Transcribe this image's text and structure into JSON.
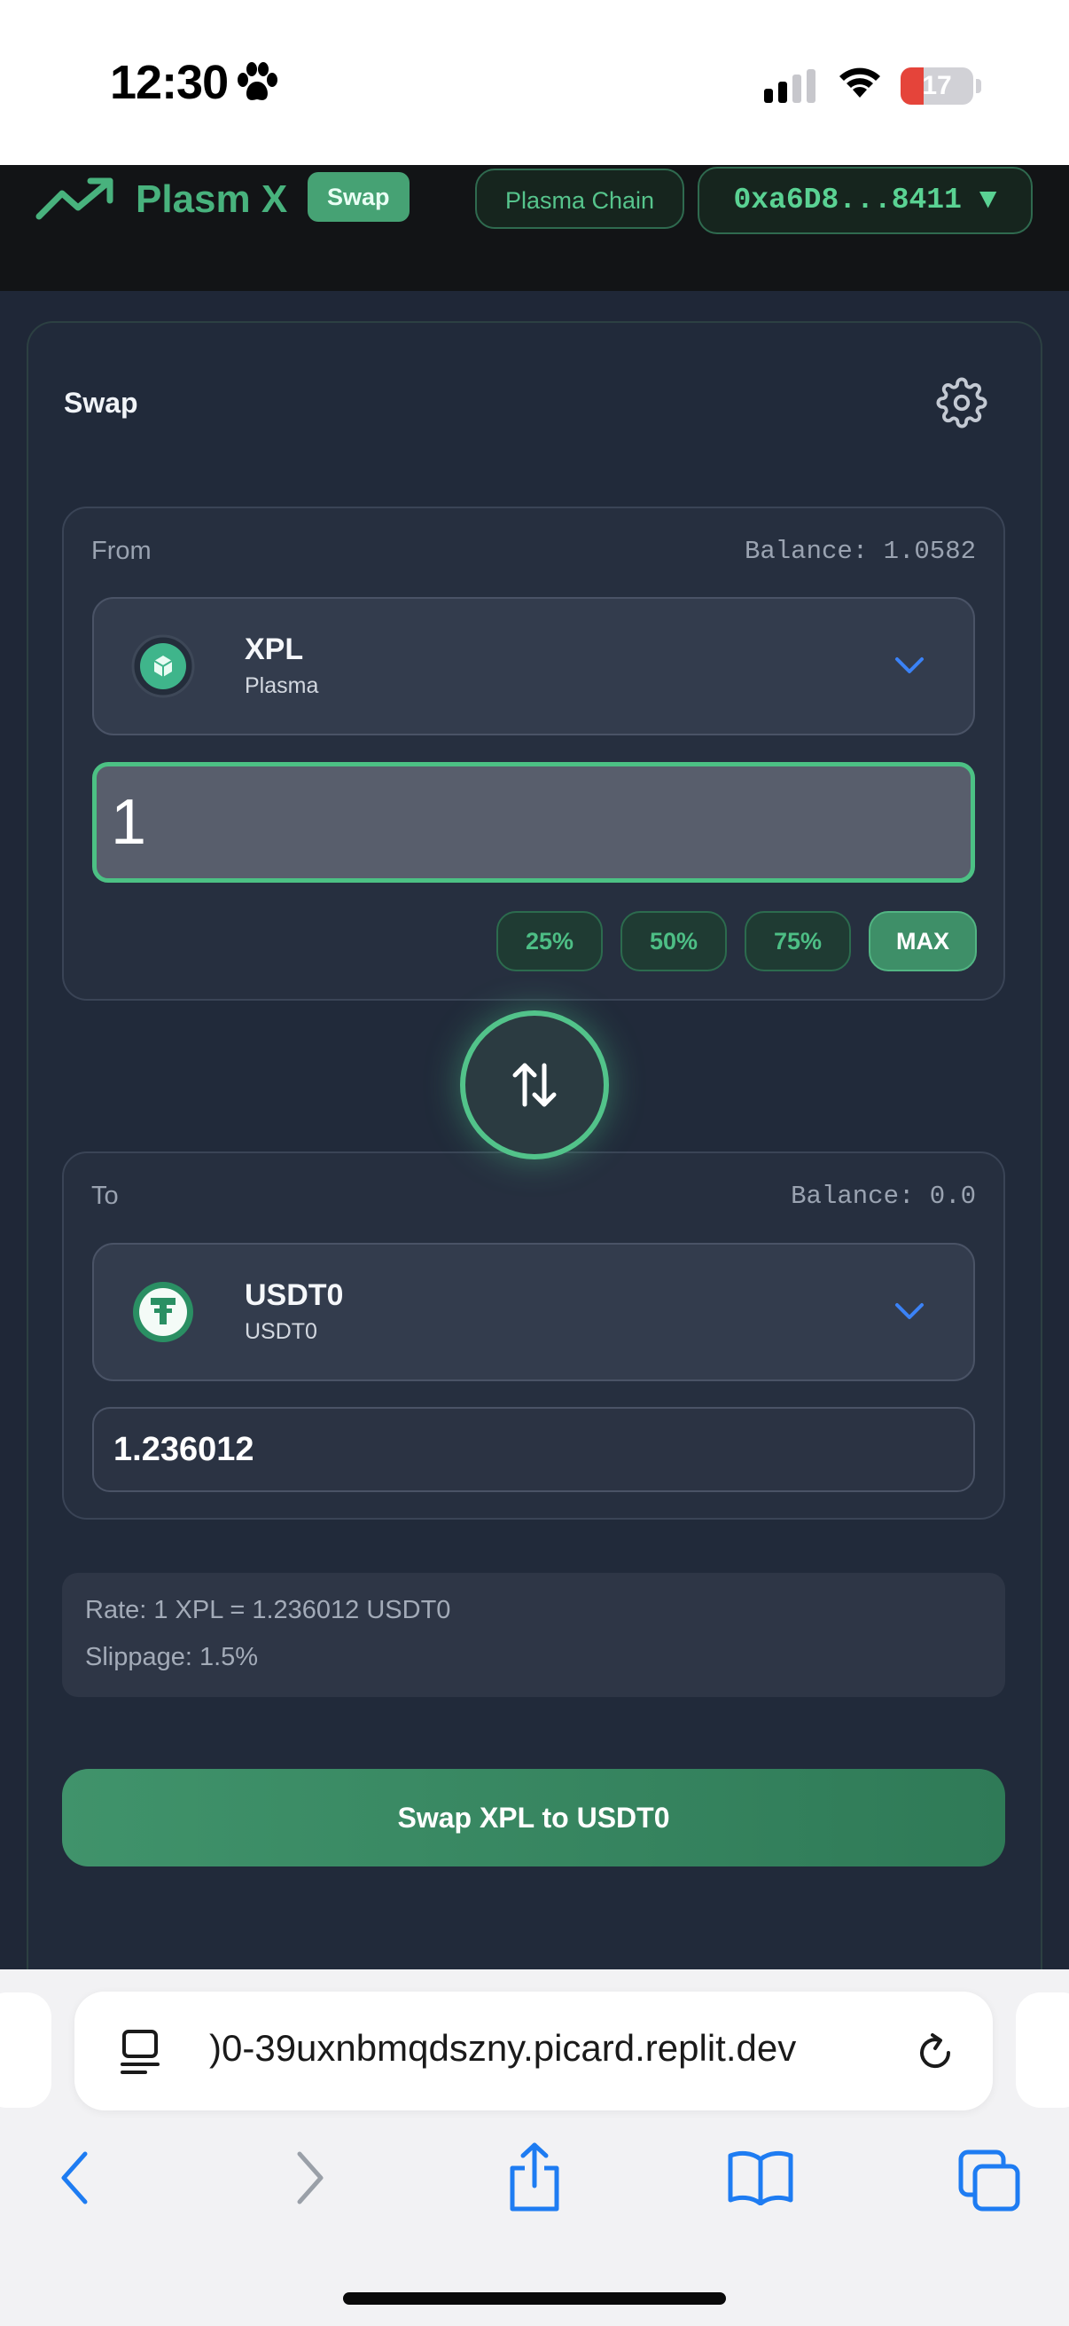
{
  "status_bar": {
    "time": "12:30",
    "battery": "17"
  },
  "header": {
    "logo": "Plasm X",
    "badge": "Swap",
    "chain": "Plasma Chain",
    "wallet": "0xa6D8...8411 ▼"
  },
  "card": {
    "title": "Swap",
    "from": {
      "label": "From",
      "balance": "Balance: 1.0582",
      "token_symbol": "XPL",
      "token_network": "Plasma",
      "amount": "1",
      "percent_buttons": [
        "25%",
        "50%",
        "75%",
        "MAX"
      ]
    },
    "to": {
      "label": "To",
      "balance": "Balance: 0.0",
      "token_symbol": "USDT0",
      "token_network": "USDT0",
      "amount": "1.236012"
    },
    "rate": "Rate: 1 XPL = 1.236012 USDT0",
    "slippage": "Slippage: 1.5%",
    "swap_button": "Swap XPL to USDT0"
  },
  "browser": {
    "url": ")0-39uxnbmqdszny.picard.replit.dev"
  },
  "colors": {
    "accent": "#48b27d",
    "chevron": "#3b82f6",
    "battery_low": "#e5443a"
  }
}
